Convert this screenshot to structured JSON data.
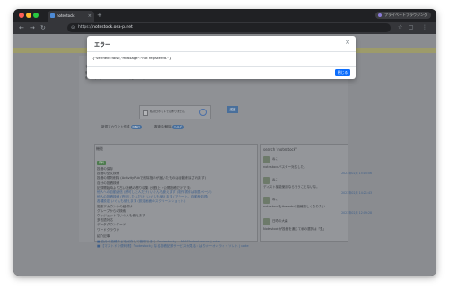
{
  "browser": {
    "tab_title": "notestock",
    "new_tab_label": "+",
    "profile_label": "プライベートブラウジング",
    "url_prefix": "https://",
    "url_host": "notestock.osa-p.net",
    "nav_back": "←",
    "nav_forward": "→",
    "nav_reload": "↻",
    "menu": "⋮"
  },
  "page": {
    "login_title": "まだ、あたらしい・ログイント (ermusu@mstdn.mnust.net",
    "login_lines": [
      "例: @mayu@mstdn.mnust.net",
      "例: https://mstdn.mnust.net/@example"
    ],
    "captcha_text": "私はロボットではありません",
    "send_button": "送信",
    "pill_new": "新規アカウント作成",
    "pill_new_badge": "NEW!",
    "pill_guide": "審査中/解除",
    "pill_guide_badge": "ヘルプ",
    "func_title": "機能",
    "func_tag": "有料",
    "func_lines": [
      "投稿の保存",
      "投稿の全文検索",
      "投稿の規則削除 (ActivityPubで削除指示が届いたものは自動削除されます)",
      "自分の投稿検索",
      "記録開始時より古い投稿の遡り収集 (分割上・公開投稿だけです)",
      "他人への自動返信 (許可した人だけ) いぐんも使えます (制作書作は制限ページ)",
      "他人の投稿検索 (許可した人だけ) いぐんも使えます (アラート、自動等処理)",
      "各種設定 いぐんも使えます (設定画面のスクリーンショット)",
      "複数アカウントの紐付け",
      "グループからの検索",
      "ウィジェットでいぐんも使えます",
      "多言語対応",
      "データダウンロード",
      "ワードクラウド"
    ],
    "intro_title": "紹介記事",
    "intro_lines": [
      "■ 自分の投稿などを保存して管理できる「notestock」 - MASTodon/unrver | note",
      "■ 【マストドン便利帳】「notestock」なる投稿記録サービスが見る：はりかーオンライ・ソルト | note"
    ],
    "search_head": "search \"notestock\"",
    "posts": [
      {
        "user": "ねこ",
        "body": "notestockバスター対応した。",
        "date": "2023年02月 15:15:06"
      },
      {
        "user": "ねこ",
        "body": "ディスト機能使用なら行うことないな。",
        "date": "2023年02月 14:21:43"
      },
      {
        "user": "ねこ",
        "body": "notestockもthreadsの投稿欲しくなりたい",
        "date": "2023年02月 12:09:28"
      },
      {
        "user": "日曜の大森",
        "body": "Notestockが投稿を通じて私の選択は「見」",
        "date": ""
      }
    ]
  },
  "modal": {
    "title": "エラー",
    "close_glyph": "×",
    "body": "{\"verified\":false,\"message\":\"not registered.\"}",
    "button": "閉じる"
  },
  "colors": {
    "modal_button": "#0d6efd",
    "overlay_bg": "#8a8c90"
  }
}
